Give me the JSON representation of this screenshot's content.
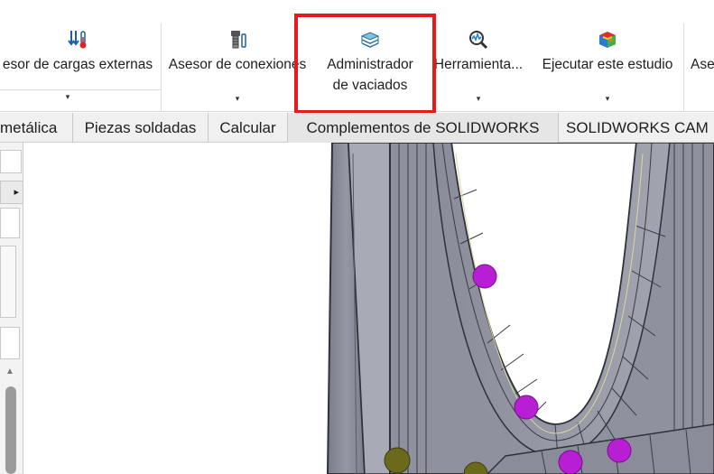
{
  "ribbon": {
    "buttons": [
      {
        "label": "esor de cargas externas",
        "icon": "external-loads-icon",
        "has_dropdown": true
      },
      {
        "label": "Asesor de conexiones",
        "icon": "connections-icon",
        "has_dropdown": true
      },
      {
        "label_line1": "Administrador",
        "label_line2": "de vaciados",
        "icon": "dump-manager-icon",
        "has_dropdown": false,
        "highlighted": true
      },
      {
        "label": "Herramienta...",
        "icon": "tools-icon",
        "has_dropdown": true
      },
      {
        "label": "Ejecutar este estudio",
        "icon": "run-study-icon",
        "has_dropdown": true
      },
      {
        "label": "Ase",
        "icon": "",
        "has_dropdown": false
      }
    ],
    "dropdown_glyph": "▾"
  },
  "tabs": [
    "metálica",
    "Piezas soldadas",
    "Calcular",
    "Complementos de SOLIDWORKS",
    "SOLIDWORKS CAM"
  ],
  "active_tab": "Complementos de SOLIDWORKS",
  "left_panel": {
    "expand_glyph": "▸",
    "scroll_up_glyph": "▲"
  },
  "colors": {
    "highlight": "#e8191b",
    "model_surface": "#8f919f",
    "marker_magenta": "#b81ed4",
    "marker_olive": "#6b6a1c"
  }
}
